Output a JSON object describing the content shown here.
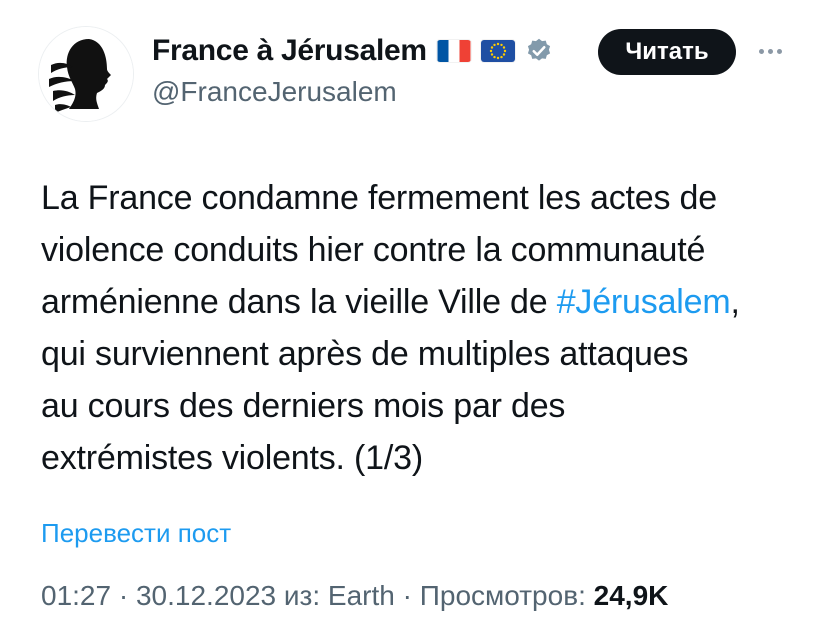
{
  "author": {
    "display_name": "France à Jérusalem",
    "handle": "@FranceJerusalem",
    "badges": [
      "flag-france-icon",
      "flag-eu-icon",
      "verified-badge-icon"
    ]
  },
  "actions": {
    "follow_label": "Читать",
    "more_icon": "more-options-icon"
  },
  "tweet": {
    "line1": "La France condamne fermement les actes de",
    "line2": "violence conduits hier contre la communauté",
    "line3_before": "arménienne dans la vieille Ville de ",
    "hashtag": "#Jérusalem",
    "line3_after": ",",
    "line4": "qui surviennent après de multiples attaques",
    "line5": "au cours des derniers mois par des",
    "line6": "extrémistes violents. (1/3)"
  },
  "translate_label": "Перевести пост",
  "meta": {
    "time": "01:27",
    "sep1": " · ",
    "date": "30.12.2023",
    "source": " из: Earth",
    "sep2": " · ",
    "views_label": "Просмотров: ",
    "views_count": "24,9K"
  },
  "colors": {
    "link": "#1d9bf0",
    "text": "#0f1419",
    "secondary": "#536471",
    "button_bg": "#0f1419"
  }
}
